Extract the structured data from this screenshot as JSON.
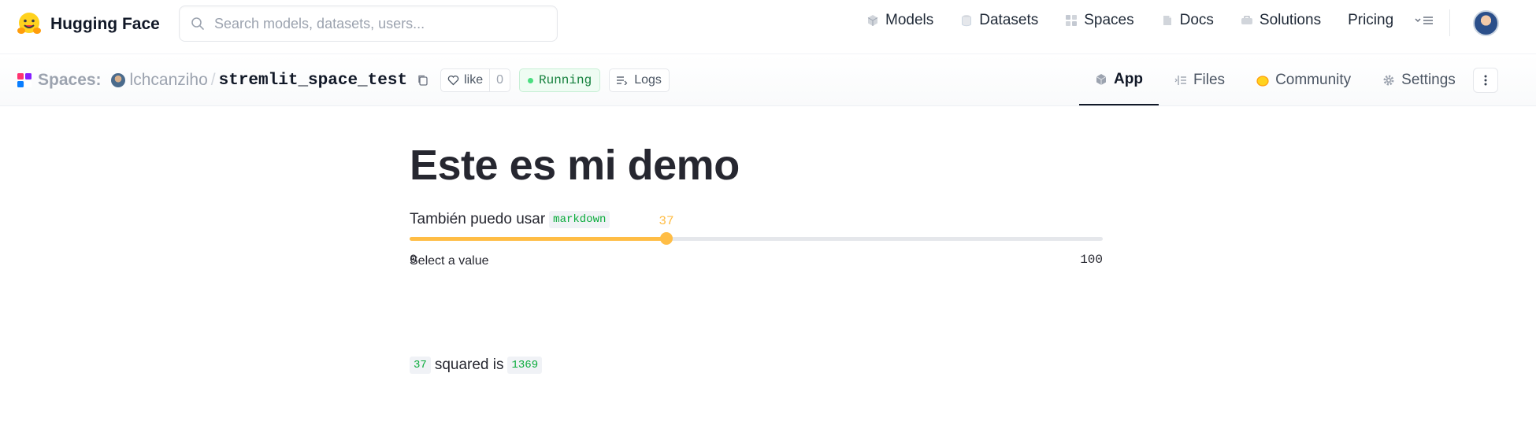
{
  "topnav": {
    "brand": "Hugging Face",
    "search_placeholder": "Search models, datasets, users...",
    "links": [
      {
        "label": "Models",
        "icon": "models-icon"
      },
      {
        "label": "Datasets",
        "icon": "datasets-icon"
      },
      {
        "label": "Spaces",
        "icon": "spaces-icon"
      },
      {
        "label": "Docs",
        "icon": "docs-icon"
      },
      {
        "label": "Solutions",
        "icon": "solutions-icon"
      },
      {
        "label": "Pricing",
        "icon": ""
      }
    ]
  },
  "space": {
    "section_label": "Spaces:",
    "owner": "lchcanziho",
    "separator": "/",
    "repo": "stremlit_space_test",
    "like_label": "like",
    "like_count": "0",
    "status": "Running",
    "logs_label": "Logs",
    "tabs": [
      {
        "label": "App",
        "icon": "app-icon",
        "active": true
      },
      {
        "label": "Files",
        "icon": "files-icon",
        "active": false
      },
      {
        "label": "Community",
        "icon": "community-icon",
        "active": false
      },
      {
        "label": "Settings",
        "icon": "settings-icon",
        "active": false
      }
    ]
  },
  "app": {
    "title": "Este es mi demo",
    "paragraph_text": "También puedo usar",
    "paragraph_code": "markdown",
    "slider_label": "Select a value",
    "slider": {
      "value": 37,
      "min": 0,
      "max": 100,
      "value_label": "37",
      "min_label": "0",
      "max_label": "100"
    },
    "result_value": "37",
    "result_text": "squared is",
    "result_output": "1369"
  },
  "colors": {
    "slider_accent": "#ffbd45",
    "code_text": "#09ab3b",
    "running_text": "#15803d"
  }
}
